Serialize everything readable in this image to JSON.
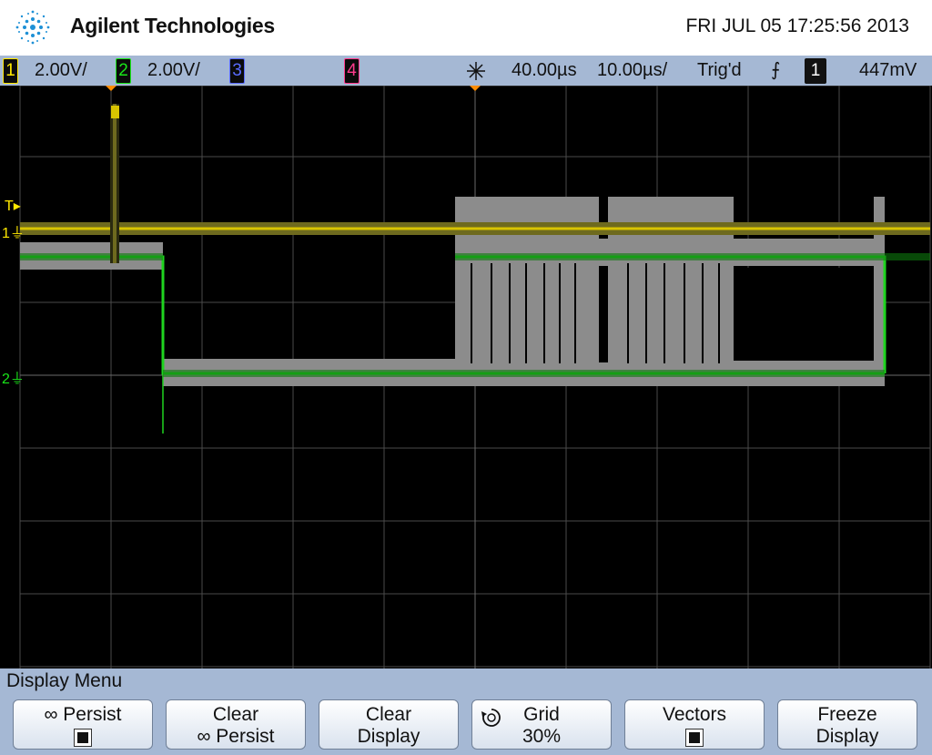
{
  "header": {
    "brand": "Agilent Technologies",
    "datetime": "FRI JUL 05 17:25:56 2013"
  },
  "status": {
    "ch1_num": "1",
    "ch1_scale": "2.00V/",
    "ch2_num": "2",
    "ch2_scale": "2.00V/",
    "ch3_num": "3",
    "ch4_num": "4",
    "time_delay": "40.00µs",
    "time_scale": "10.00µs/",
    "trigger_state": "Trig'd",
    "trigger_slope": "⨍",
    "trigger_source": "1",
    "trigger_level": "447mV"
  },
  "markers": {
    "trigger_label": "T",
    "ch1_label": "1",
    "ch2_label": "2"
  },
  "menu": {
    "title": "Display Menu",
    "keys": [
      {
        "line1": "∞ Persist",
        "line2": ""
      },
      {
        "line1": "Clear",
        "line2": "∞ Persist"
      },
      {
        "line1": "Clear",
        "line2": "Display"
      },
      {
        "line1": "Grid",
        "line2": "30%"
      },
      {
        "line1": "Vectors",
        "line2": ""
      },
      {
        "line1": "Freeze",
        "line2": "Display"
      }
    ]
  },
  "colors": {
    "ch1": "#ffe800",
    "ch2": "#19e619",
    "statusbar": "#a5b8d4",
    "grid": "#555555"
  },
  "icons": [
    "agilent-spark-logo",
    "horizontal-delay-icon",
    "rising-edge-icon",
    "rotary-knob-icon",
    "checkbox-checked-icon"
  ]
}
